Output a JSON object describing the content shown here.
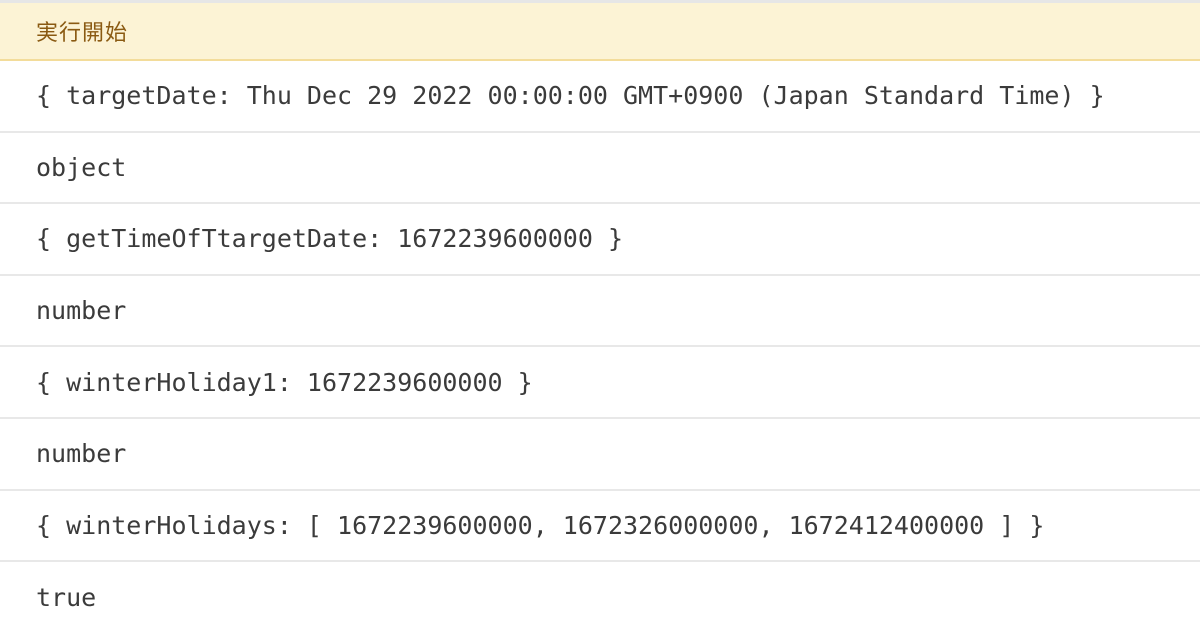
{
  "header": {
    "title": "実行開始"
  },
  "log": {
    "lines": [
      "{ targetDate: Thu Dec 29 2022 00:00:00 GMT+0900 (Japan Standard Time) }",
      "object",
      "{ getTimeOfTtargetDate: 1672239600000 }",
      "number",
      "{ winterHoliday1: 1672239600000 }",
      "number",
      "{ winterHolidays: [ 1672239600000, 1672326000000, 1672412400000 ] }",
      "true"
    ]
  },
  "colors": {
    "header_bg": "#fcf3d5",
    "header_text": "#8a5a12",
    "row_divider": "#e8e8e8",
    "log_text": "#3b3b3b"
  }
}
